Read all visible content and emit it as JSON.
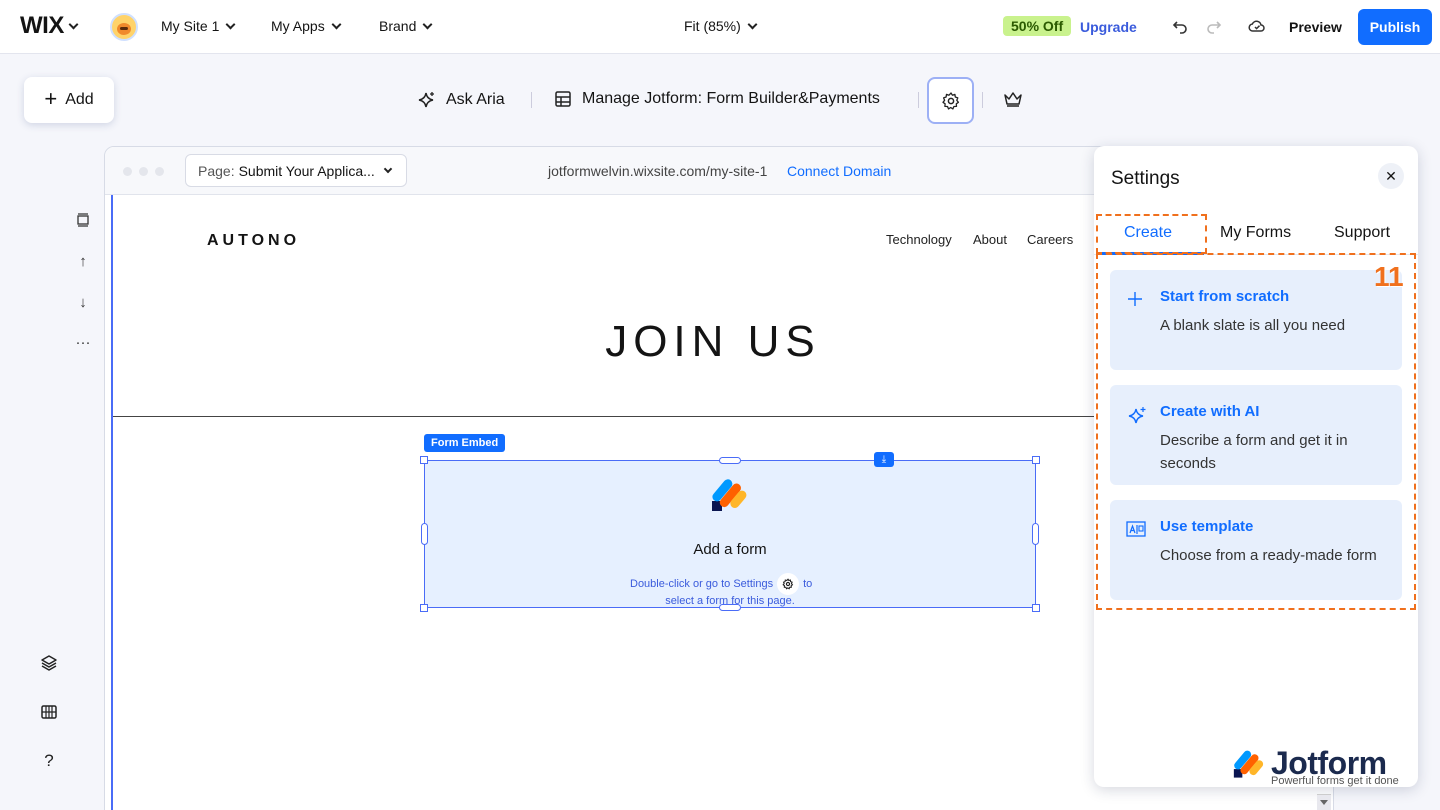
{
  "topbar": {
    "logo": "WIX",
    "site_menu": "My Site 1",
    "apps_menu": "My Apps",
    "brand_menu": "Brand",
    "zoom": "Fit (85%)",
    "discount_badge": "50% Off",
    "upgrade_label": "Upgrade",
    "preview_label": "Preview",
    "publish_label": "Publish"
  },
  "toolbar": {
    "add_label": "Add",
    "ask_aria_label": "Ask Aria",
    "app_name": "Manage Jotform: Form Builder&Payments"
  },
  "browser": {
    "page_label": "Page:",
    "page_value": "Submit Your Applica...",
    "url": "jotformwelvin.wixsite.com/my-site-1",
    "connect_domain": "Connect Domain"
  },
  "site": {
    "brand": "AUTONO",
    "nav": [
      "Technology",
      "About",
      "Careers"
    ],
    "heading": "JOIN US"
  },
  "form_embed": {
    "tag": "Form Embed",
    "title": "Add a form",
    "hint_line1_prefix": "Double-click or go to Settings",
    "hint_line1_suffix": "to",
    "hint_line2": "select a form for this page."
  },
  "settings_panel": {
    "title": "Settings",
    "tabs": [
      {
        "label": "Create",
        "active": true
      },
      {
        "label": "My Forms",
        "active": false
      },
      {
        "label": "Support",
        "active": false
      }
    ],
    "step_number": "11",
    "cards": [
      {
        "icon": "plus-icon",
        "title": "Start from scratch",
        "description": "A blank slate is all you need"
      },
      {
        "icon": "sparkle-icon",
        "title": "Create with AI",
        "description": "Describe a form and get it in seconds"
      },
      {
        "icon": "template-icon",
        "title": "Use template",
        "description": "Choose from a ready-made form"
      }
    ]
  },
  "watermark": {
    "name": "Jotform",
    "tagline": "Powerful forms get it done"
  },
  "colors": {
    "accent": "#116dff",
    "highlight": "#f0701d",
    "badge_bg": "#c9f28d"
  }
}
